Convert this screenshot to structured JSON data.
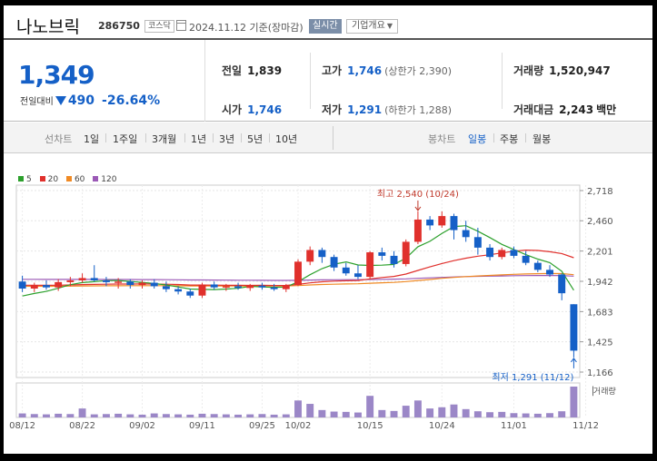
{
  "header": {
    "name": "나노브릭",
    "code": "286750",
    "market": "코스닥",
    "date": "2024.11.12",
    "basis": "기준(장마감)",
    "realtime_label": "실시간",
    "company_info_label": "기업개요",
    "calendar_icon": "calendar-icon",
    "dropdown_icon": "chevron-down-icon"
  },
  "price": {
    "current": "1,349",
    "change_label": "전일대비",
    "change_amount": "490",
    "change_rate": "-26.64%",
    "direction_icon": "down-triangle-icon",
    "down_color": "#1560c7"
  },
  "stats": {
    "prev_close_label": "전일",
    "prev_close": "1,839",
    "high_label": "고가",
    "high": "1,746",
    "upper_limit": "(상한가 2,390)",
    "volume_label": "거래량",
    "volume": "1,520,947",
    "open_label": "시가",
    "open": "1,746",
    "low_label": "저가",
    "low": "1,291",
    "lower_limit": "(하한가 1,288)",
    "amount_label": "거래대금",
    "amount": "2,243",
    "amount_unit": "백만"
  },
  "periods": {
    "line_label": "선차트",
    "line_tabs": [
      "1일",
      "1주일",
      "3개월",
      "1년",
      "3년",
      "5년",
      "10년"
    ],
    "candle_label": "봉차트",
    "candle_tabs": [
      "일봉",
      "주봉",
      "월봉"
    ],
    "active_candle": "일봉"
  },
  "chart_data": {
    "type": "candlestick",
    "legend": [
      {
        "name": "5",
        "color": "#2ca02c"
      },
      {
        "name": "20",
        "color": "#e0302c"
      },
      {
        "name": "60",
        "color": "#f08a24"
      },
      {
        "name": "120",
        "color": "#9b59b6"
      }
    ],
    "colors": {
      "up": "#e0302c",
      "down": "#1560c7",
      "volume": "#9b87c7"
    },
    "y_ticks": [
      "2,718",
      "2,460",
      "2,201",
      "1,942",
      "1,683",
      "1,425",
      "1,166"
    ],
    "ylim": [
      1166,
      2718
    ],
    "x_ticks": [
      {
        "index": 0,
        "label": "08/12"
      },
      {
        "index": 5,
        "label": "08/22"
      },
      {
        "index": 10,
        "label": "09/02"
      },
      {
        "index": 15,
        "label": "09/11"
      },
      {
        "index": 20,
        "label": "09/25"
      },
      {
        "index": 23,
        "label": "10/02"
      },
      {
        "index": 29,
        "label": "10/15"
      },
      {
        "index": 35,
        "label": "10/24"
      },
      {
        "index": 41,
        "label": "11/01"
      },
      {
        "index": 47,
        "label": "11/12"
      }
    ],
    "volume_label": "거래량",
    "max_annotation": "최고 2,540 (10/24)",
    "min_annotation": "최저 1,291 (11/12)",
    "candles": [
      {
        "o": 1940,
        "h": 1990,
        "l": 1850,
        "c": 1880
      },
      {
        "o": 1880,
        "h": 1930,
        "l": 1850,
        "c": 1910
      },
      {
        "o": 1910,
        "h": 1950,
        "l": 1870,
        "c": 1890
      },
      {
        "o": 1890,
        "h": 1960,
        "l": 1860,
        "c": 1935
      },
      {
        "o": 1935,
        "h": 1980,
        "l": 1900,
        "c": 1950
      },
      {
        "o": 1950,
        "h": 2010,
        "l": 1930,
        "c": 1970
      },
      {
        "o": 1970,
        "h": 2080,
        "l": 1940,
        "c": 1950
      },
      {
        "o": 1950,
        "h": 1980,
        "l": 1900,
        "c": 1935
      },
      {
        "o": 1935,
        "h": 1970,
        "l": 1880,
        "c": 1940
      },
      {
        "o": 1940,
        "h": 1960,
        "l": 1880,
        "c": 1910
      },
      {
        "o": 1910,
        "h": 1950,
        "l": 1880,
        "c": 1930
      },
      {
        "o": 1930,
        "h": 1960,
        "l": 1880,
        "c": 1900
      },
      {
        "o": 1900,
        "h": 1940,
        "l": 1850,
        "c": 1875
      },
      {
        "o": 1875,
        "h": 1900,
        "l": 1830,
        "c": 1855
      },
      {
        "o": 1855,
        "h": 1880,
        "l": 1800,
        "c": 1820
      },
      {
        "o": 1820,
        "h": 1930,
        "l": 1800,
        "c": 1915
      },
      {
        "o": 1915,
        "h": 1940,
        "l": 1870,
        "c": 1890
      },
      {
        "o": 1890,
        "h": 1920,
        "l": 1860,
        "c": 1900
      },
      {
        "o": 1900,
        "h": 1930,
        "l": 1870,
        "c": 1885
      },
      {
        "o": 1885,
        "h": 1920,
        "l": 1860,
        "c": 1905
      },
      {
        "o": 1905,
        "h": 1930,
        "l": 1870,
        "c": 1890
      },
      {
        "o": 1890,
        "h": 1920,
        "l": 1860,
        "c": 1875
      },
      {
        "o": 1875,
        "h": 1920,
        "l": 1850,
        "c": 1910
      },
      {
        "o": 1910,
        "h": 2130,
        "l": 1900,
        "c": 2110
      },
      {
        "o": 2110,
        "h": 2240,
        "l": 2080,
        "c": 2210
      },
      {
        "o": 2210,
        "h": 2230,
        "l": 2100,
        "c": 2150
      },
      {
        "o": 2150,
        "h": 2170,
        "l": 2030,
        "c": 2060
      },
      {
        "o": 2060,
        "h": 2100,
        "l": 1990,
        "c": 2010
      },
      {
        "o": 2010,
        "h": 2080,
        "l": 1960,
        "c": 1980
      },
      {
        "o": 1980,
        "h": 2200,
        "l": 1960,
        "c": 2190
      },
      {
        "o": 2190,
        "h": 2230,
        "l": 2120,
        "c": 2160
      },
      {
        "o": 2160,
        "h": 2200,
        "l": 2060,
        "c": 2090
      },
      {
        "o": 2090,
        "h": 2300,
        "l": 2070,
        "c": 2280
      },
      {
        "o": 2280,
        "h": 2540,
        "l": 2260,
        "c": 2470
      },
      {
        "o": 2470,
        "h": 2500,
        "l": 2380,
        "c": 2420
      },
      {
        "o": 2420,
        "h": 2540,
        "l": 2400,
        "c": 2500
      },
      {
        "o": 2500,
        "h": 2520,
        "l": 2300,
        "c": 2380
      },
      {
        "o": 2380,
        "h": 2460,
        "l": 2280,
        "c": 2320
      },
      {
        "o": 2320,
        "h": 2400,
        "l": 2170,
        "c": 2230
      },
      {
        "o": 2230,
        "h": 2260,
        "l": 2120,
        "c": 2150
      },
      {
        "o": 2150,
        "h": 2230,
        "l": 2130,
        "c": 2210
      },
      {
        "o": 2210,
        "h": 2240,
        "l": 2140,
        "c": 2160
      },
      {
        "o": 2160,
        "h": 2200,
        "l": 2080,
        "c": 2100
      },
      {
        "o": 2100,
        "h": 2120,
        "l": 2020,
        "c": 2040
      },
      {
        "o": 2040,
        "h": 2080,
        "l": 1980,
        "c": 2000
      },
      {
        "o": 2000,
        "h": 2010,
        "l": 1780,
        "c": 1840
      },
      {
        "o": 1746,
        "h": 1746,
        "l": 1291,
        "c": 1349
      }
    ],
    "volume": [
      13,
      11,
      10,
      12,
      11,
      29,
      10,
      11,
      12,
      10,
      9,
      13,
      11,
      10,
      9,
      12,
      11,
      10,
      9,
      10,
      11,
      9,
      10,
      55,
      44,
      24,
      19,
      18,
      16,
      70,
      24,
      21,
      38,
      55,
      29,
      33,
      42,
      27,
      20,
      17,
      18,
      14,
      13,
      12,
      14,
      20,
      100
    ]
  }
}
